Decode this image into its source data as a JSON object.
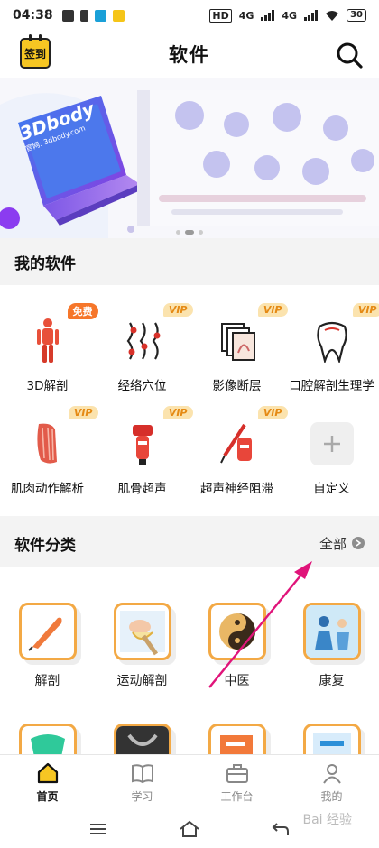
{
  "status_bar": {
    "time": "04:38",
    "network": "4G",
    "network2": "4G",
    "hd": "HD",
    "battery": "30"
  },
  "header": {
    "title": "软件",
    "checkin_label": "签到"
  },
  "banner": {
    "laptop_brand": "3Dbody",
    "laptop_url": "官网: 3dbody.com"
  },
  "my_software": {
    "title": "我的软件",
    "items": [
      {
        "label": "3D解剖",
        "badge": "免费"
      },
      {
        "label": "经络穴位",
        "badge": "VIP"
      },
      {
        "label": "影像断层",
        "badge": "VIP"
      },
      {
        "label": "口腔解剖生理学",
        "badge": "VIP"
      },
      {
        "label": "肌肉动作解析",
        "badge": "VIP"
      },
      {
        "label": "肌骨超声",
        "badge": "VIP"
      },
      {
        "label": "超声神经阻滞",
        "badge": "VIP"
      },
      {
        "label": "自定义",
        "badge": ""
      }
    ]
  },
  "categories": {
    "title": "软件分类",
    "more_label": "全部",
    "items": [
      {
        "label": "解剖"
      },
      {
        "label": "运动解剖"
      },
      {
        "label": "中医"
      },
      {
        "label": "康复"
      }
    ]
  },
  "tabbar": {
    "tabs": [
      {
        "label": "首页",
        "icon": "home-icon"
      },
      {
        "label": "学习",
        "icon": "book-icon"
      },
      {
        "label": "工作台",
        "icon": "briefcase-icon"
      },
      {
        "label": "我的",
        "icon": "person-icon"
      }
    ]
  },
  "watermark": "Bai 经验",
  "colors": {
    "accent": "#f3a945",
    "vip_bg": "#fbe3ae",
    "vip_text": "#e58a14",
    "free_bg": "#f6762a",
    "arrow": "#e0147a"
  }
}
